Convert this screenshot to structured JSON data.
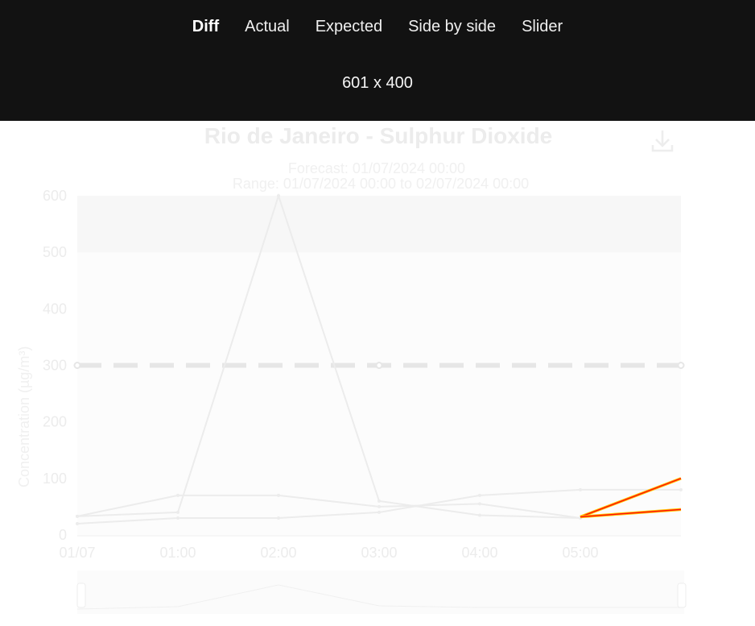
{
  "toolbar": {
    "tabs": [
      {
        "label": "Diff",
        "active": true
      },
      {
        "label": "Actual",
        "active": false
      },
      {
        "label": "Expected",
        "active": false
      },
      {
        "label": "Side by side",
        "active": false
      },
      {
        "label": "Slider",
        "active": false
      }
    ],
    "dimensions": "601 x 400"
  },
  "chart_data": {
    "type": "line",
    "title": "Rio de Janeiro - Sulphur Dioxide",
    "subtitle_forecast": "Forecast: 01/07/2024 00:00",
    "subtitle_range": "Range: 01/07/2024 00:00 to 02/07/2024 00:00",
    "ylabel": "Concentration (µg/m³)",
    "ylim": [
      0,
      600
    ],
    "yticks": [
      "0",
      "100",
      "200",
      "300",
      "400",
      "500",
      "600"
    ],
    "xticks": [
      "01/07",
      "01:00",
      "02:00",
      "03:00",
      "04:00",
      "05:00"
    ],
    "x_hours": [
      0,
      1,
      2,
      3,
      4,
      5,
      6
    ],
    "threshold": 300,
    "bands": [
      {
        "from": 0,
        "to": 500
      },
      {
        "from": 500,
        "to": 600
      }
    ],
    "series": [
      {
        "values": [
          33,
          40,
          600,
          60,
          35,
          30,
          null
        ]
      },
      {
        "values": [
          33,
          70,
          70,
          50,
          55,
          30,
          null
        ]
      },
      {
        "values": [
          20,
          30,
          30,
          40,
          70,
          80,
          80
        ]
      }
    ],
    "diff_segments": [
      {
        "from": [
          5,
          32
        ],
        "to": [
          6,
          100
        ]
      },
      {
        "from": [
          5,
          32
        ],
        "to": [
          6,
          45
        ]
      }
    ],
    "colors": {
      "faint": "#ececec",
      "diff": "#ff1100",
      "diff_edge": "#ffc400"
    }
  }
}
